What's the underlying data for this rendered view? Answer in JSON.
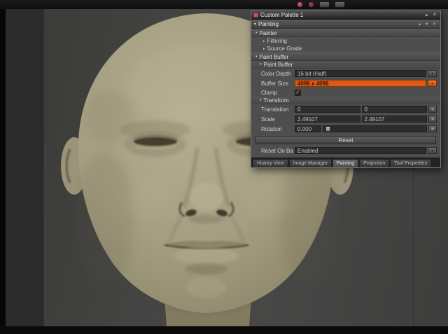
{
  "icons": {
    "close": "✕",
    "rollup": "▴",
    "collapse": "▾",
    "expand": "▸",
    "dropdown": "▼",
    "keyframe": "◆",
    "check": "✓"
  },
  "colors": {
    "accent_orange": "#dc5a16",
    "palette_icon_pink": "#c9536b",
    "model_skin": "#a7a083"
  },
  "palette": {
    "title": "Custom Palette 1",
    "form_header": "Painting",
    "sections": {
      "painter": "Painter",
      "filtering": "Filtering",
      "source_grade": "Source Grade",
      "paint_buffer": "Paint Buffer",
      "paint_buffer_sub": "Paint Buffer",
      "transform": "Transform"
    },
    "fields": {
      "color_depth": {
        "label": "Color Depth",
        "value": "16 bit (Half)"
      },
      "buffer_size": {
        "label": "Buffer Size",
        "value": "4096 x 4096"
      },
      "clamp": {
        "label": "Clamp",
        "checked": true
      },
      "translation": {
        "label": "Translation",
        "x": "0",
        "y": "0"
      },
      "scale": {
        "label": "Scale",
        "x": "2.49107",
        "y": "2.49107"
      },
      "rotation": {
        "label": "Rotation",
        "value": "0.000"
      },
      "reset_button": "Reset",
      "reset_on_bake": {
        "label": "Reset On Bake",
        "value": "Enabled"
      }
    },
    "bottom_tabs": [
      {
        "label": "History View",
        "active": false
      },
      {
        "label": "Image Manager",
        "active": false
      },
      {
        "label": "Painting",
        "active": true
      },
      {
        "label": "Projection",
        "active": false
      },
      {
        "label": "Tool Properties",
        "active": false
      }
    ]
  }
}
